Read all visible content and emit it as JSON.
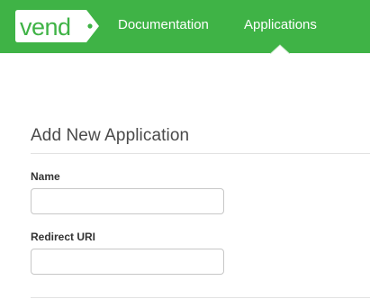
{
  "brand": {
    "logo_text": "vend",
    "color": "#3fb346"
  },
  "nav": {
    "items": [
      {
        "label": "Documentation"
      },
      {
        "label": "Applications",
        "active": true
      }
    ]
  },
  "form": {
    "title": "Add New Application",
    "name_label": "Name",
    "name_value": "",
    "redirect_label": "Redirect URI",
    "redirect_value": ""
  }
}
